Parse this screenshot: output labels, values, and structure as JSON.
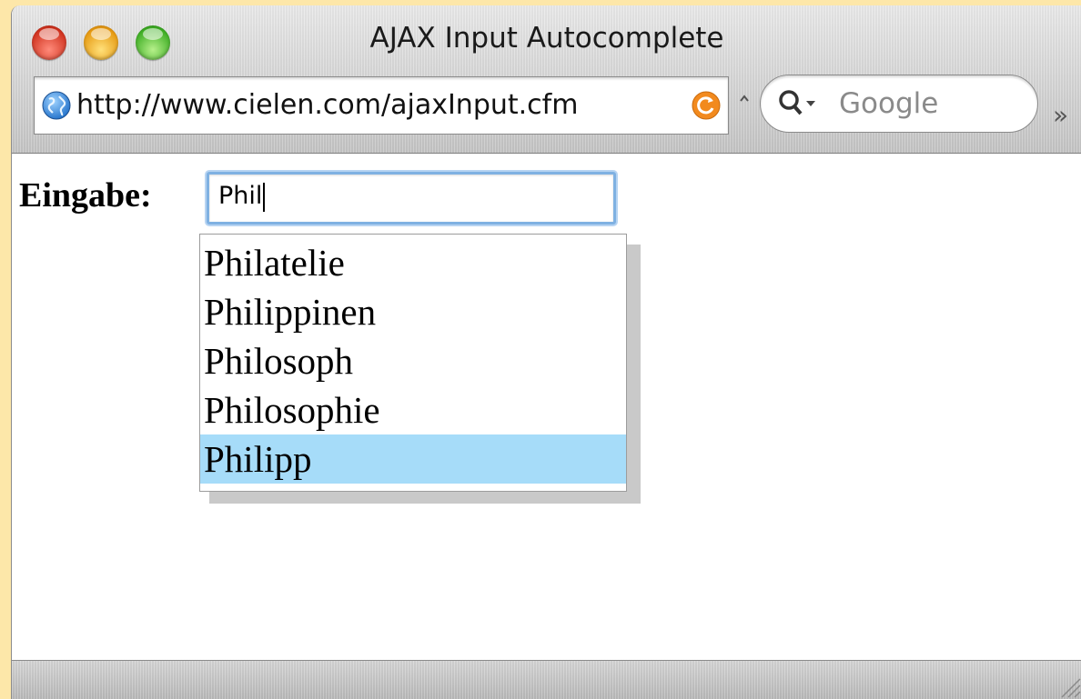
{
  "window": {
    "title": "AJAX Input Autocomplete"
  },
  "toolbar": {
    "url": "http://www.cielen.com/ajaxInput.cfm",
    "search_placeholder": "Google",
    "overflow_glyph": "»"
  },
  "form": {
    "label": "Eingabe:",
    "value": "Phil"
  },
  "suggestions": {
    "items": [
      "Philatelie",
      "Philippinen",
      "Philosoph",
      "Philosophie",
      "Philipp"
    ],
    "selected_index": 4
  },
  "colors": {
    "background": "#fde7a9",
    "selection": "#a6dcf9",
    "focus_ring": "#7fb1e2"
  }
}
